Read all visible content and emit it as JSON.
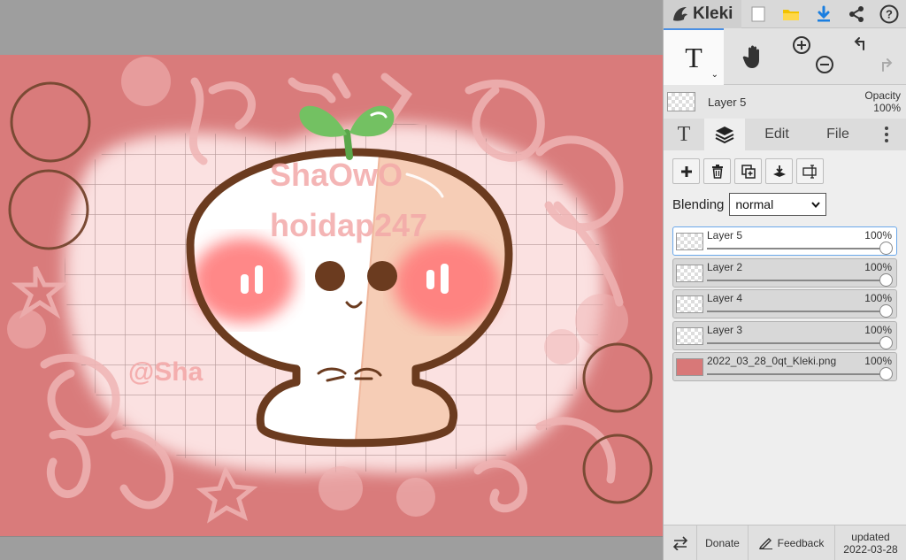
{
  "app": {
    "name": "Kleki"
  },
  "topbar": {
    "icons": [
      "new-image-icon",
      "open-folder-icon",
      "download-icon",
      "share-icon",
      "help-icon"
    ]
  },
  "tools": {
    "active": "text-tool",
    "items": [
      "text-tool",
      "hand-tool",
      "zoom-in-out",
      "undo-redo"
    ],
    "text_glyph": "T"
  },
  "current_layer": {
    "name": "Layer 5",
    "opacity_label": "Opacity",
    "opacity_value": "100%"
  },
  "tabs": [
    {
      "id": "text",
      "label": "T"
    },
    {
      "id": "layers",
      "label": ""
    },
    {
      "id": "edit",
      "label": "Edit"
    },
    {
      "id": "file",
      "label": "File"
    }
  ],
  "layer_panel": {
    "blending_label": "Blending",
    "blending_value": "normal",
    "layers": [
      {
        "name": "Layer 5",
        "opacity": "100%",
        "selected": true
      },
      {
        "name": "Layer 2",
        "opacity": "100%",
        "selected": false
      },
      {
        "name": "Layer 4",
        "opacity": "100%",
        "selected": false
      },
      {
        "name": "Layer 3",
        "opacity": "100%",
        "selected": false
      },
      {
        "name": "2022_03_28_0qt_Kleki.png",
        "opacity": "100%",
        "selected": false
      }
    ]
  },
  "footer": {
    "donate": "Donate",
    "feedback": "Feedback",
    "updated_label": "updated",
    "updated_date": "2022-03-28"
  },
  "artwork": {
    "watermark_line1": "ShaOwO",
    "watermark_line2": "hoidap247",
    "signature": "@Sha",
    "colors": {
      "background": "#d97b7b",
      "frame": "#9e9e9e",
      "grid_bg": "#fbe1e1",
      "outline": "#6b3b1f",
      "blush": "#ff7b7b",
      "leaf": "#73c162",
      "peach": "#f6cdb6"
    }
  }
}
